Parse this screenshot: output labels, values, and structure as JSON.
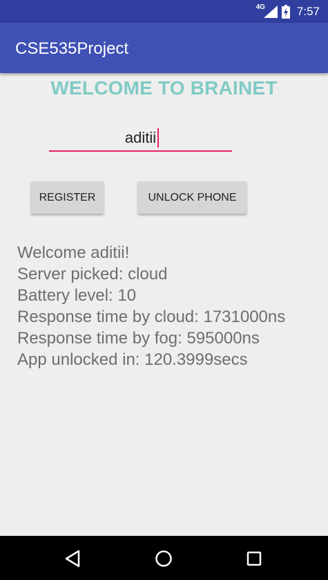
{
  "status_bar": {
    "network_type": "4G",
    "time": "7:57",
    "icons": [
      "signal-icon",
      "battery-charging-icon"
    ]
  },
  "app_bar": {
    "title": "CSE535Project"
  },
  "main": {
    "heading": "WELCOME TO BRAINET",
    "name_input_value": "aditii",
    "register_button": "REGISTER",
    "unlock_button": "UNLOCK PHONE",
    "info_lines": [
      "Welcome aditii!",
      "Server picked: cloud",
      "Battery level: 10",
      "Response time by cloud: 1731000ns",
      "Response time by fog: 595000ns",
      "App unlocked in: 120.3999secs"
    ]
  },
  "nav_bar": {
    "icons": [
      "back-icon",
      "home-icon",
      "recents-icon"
    ]
  },
  "colors": {
    "status_bar": "#303f9f",
    "app_bar": "#3f51b5",
    "heading": "#80cbc4",
    "input_underline": "#e91e63",
    "button_bg": "#d6d6d6",
    "background": "#eeeeee"
  }
}
